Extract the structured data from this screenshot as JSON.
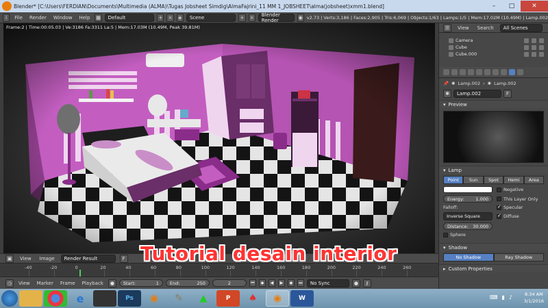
{
  "window": {
    "title": "Blender* [C:\\Users\\FERDIAN\\Documents\\Multimedia (ALMA)\\Tugas Jobsheet Simdig\\AlmaFajrini_11 MM 1_JOBSHEET\\alma(jobsheet)xmm1.blend]",
    "minimize": "–",
    "maximize": "□",
    "close": "✕"
  },
  "infobar": {
    "menus": [
      "File",
      "Render",
      "Window",
      "Help"
    ],
    "layout": "Default",
    "scene": "Scene",
    "engine": "Blender Render",
    "stats": "v2.73 | Verts:3,186 | Faces:2,905 | Tris:6,069 | Objects:1/63 | Lamps:1/5 | Mem:17.02M (10.49M) | Lamp.002"
  },
  "viewport": {
    "frame_stats": "Frame:2 | Time:00:05.03 | Ve:3186 Fa:3311 La:5 | Mem:17.03M (10.49M, Peak 39.81M)"
  },
  "image_header": {
    "menus": [
      "View",
      "Image"
    ],
    "image_name": "Render Result",
    "f_label": "F"
  },
  "ruler": {
    "ticks": [
      "-40",
      "-20",
      "0",
      "20",
      "40",
      "60",
      "80",
      "100",
      "120",
      "140",
      "160",
      "180",
      "200",
      "220",
      "240",
      "260"
    ]
  },
  "timeline": {
    "menus": [
      "View",
      "Marker",
      "Frame",
      "Playback"
    ],
    "start_label": "Start:",
    "start_value": "1",
    "end_label": "End:",
    "end_value": "250",
    "current": "2",
    "sync": "No Sync"
  },
  "outliner": {
    "menus": [
      "View",
      "Search"
    ],
    "scenes": "All Scenes",
    "rows": [
      "Camera",
      "Cube",
      "Cube.000"
    ]
  },
  "properties": {
    "crumb_lamp": "Lamp.002",
    "crumb_data": "Lamp.002",
    "datablock": "Lamp.002",
    "datablock_f": "F",
    "preview_title": "Preview",
    "lamp_title": "Lamp",
    "lamp_types": [
      "Point",
      "Sun",
      "Spot",
      "Hemi",
      "Area"
    ],
    "active_type": "Point",
    "negative": "Negative",
    "energy_label": "Energy:",
    "energy_value": "1.000",
    "this_layer_only": "This Layer Only",
    "falloff_label": "Falloff:",
    "specular": "Specular",
    "falloff_value": "Inverse Square",
    "diffuse": "Diffuse",
    "distance_label": "Distance:",
    "distance_value": "30.000",
    "sphere": "Sphere",
    "shadow_title": "Shadow",
    "no_shadow": "No Shadow",
    "ray_shadow": "Ray Shadow",
    "custom_props": "Custom Properties"
  },
  "taskbar": {
    "time": "8:34 AM",
    "date": "3/1/2016",
    "apps": [
      "start",
      "explorer",
      "chrome",
      "ie",
      "blender-launcher",
      "photoshop",
      "blender",
      "gimp",
      "autodesk",
      "powerpoint",
      "acrobat",
      "blender-active",
      "word"
    ]
  },
  "caption": "Tutorial desain interior",
  "colors": {
    "wall_pink": "#c35ec0",
    "floor_dark": "#1a1a1a",
    "accent_blue": "#5680c2",
    "caption_red": "#ff3333"
  }
}
